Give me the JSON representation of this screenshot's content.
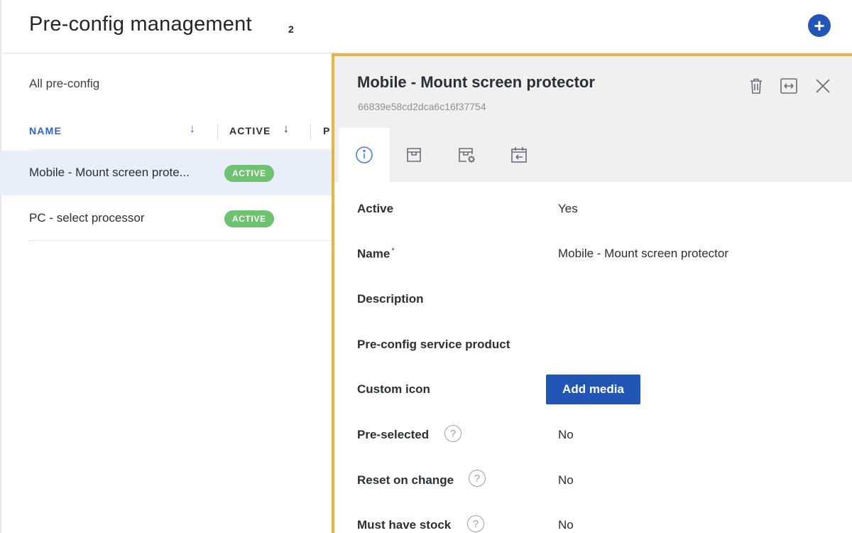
{
  "header": {
    "title": "Pre-config management",
    "count": "2",
    "add_icon": "plus-icon"
  },
  "list": {
    "filter_label": "All pre-config",
    "columns": {
      "name": "NAME",
      "active": "ACTIVE",
      "partial": "P"
    },
    "sort_icon": "↓",
    "rows": [
      {
        "name": "Mobile - Mount screen prote...",
        "status": "ACTIVE",
        "selected": true
      },
      {
        "name": "PC - select processor",
        "status": "ACTIVE",
        "selected": false
      }
    ]
  },
  "panel": {
    "title": "Mobile - Mount screen protector",
    "id": "66839e58cd2dca6c16f37754",
    "actions": [
      "trash-icon",
      "expand-horizontal-icon",
      "close-icon"
    ],
    "tabs": [
      "info-icon",
      "box-icon",
      "box-settings-icon",
      "calendar-return-icon"
    ],
    "fields": {
      "active": {
        "label": "Active",
        "value": "Yes"
      },
      "name": {
        "label": "Name",
        "required": "*",
        "value": "Mobile - Mount screen protector"
      },
      "description": {
        "label": "Description",
        "value": ""
      },
      "service_product": {
        "label": "Pre-config service product",
        "value": ""
      },
      "custom_icon": {
        "label": "Custom icon",
        "button": "Add media"
      },
      "pre_selected": {
        "label": "Pre-selected",
        "value": "No"
      },
      "reset_on_change": {
        "label": "Reset on change",
        "value": "No"
      },
      "must_have_stock": {
        "label": "Must have stock",
        "value": "No"
      }
    },
    "help_glyph": "?"
  },
  "colors": {
    "accent": "#2256b6",
    "badge_green": "#6ec26f",
    "panel_border": "#e7b53c",
    "selected_row": "#e9effa"
  }
}
